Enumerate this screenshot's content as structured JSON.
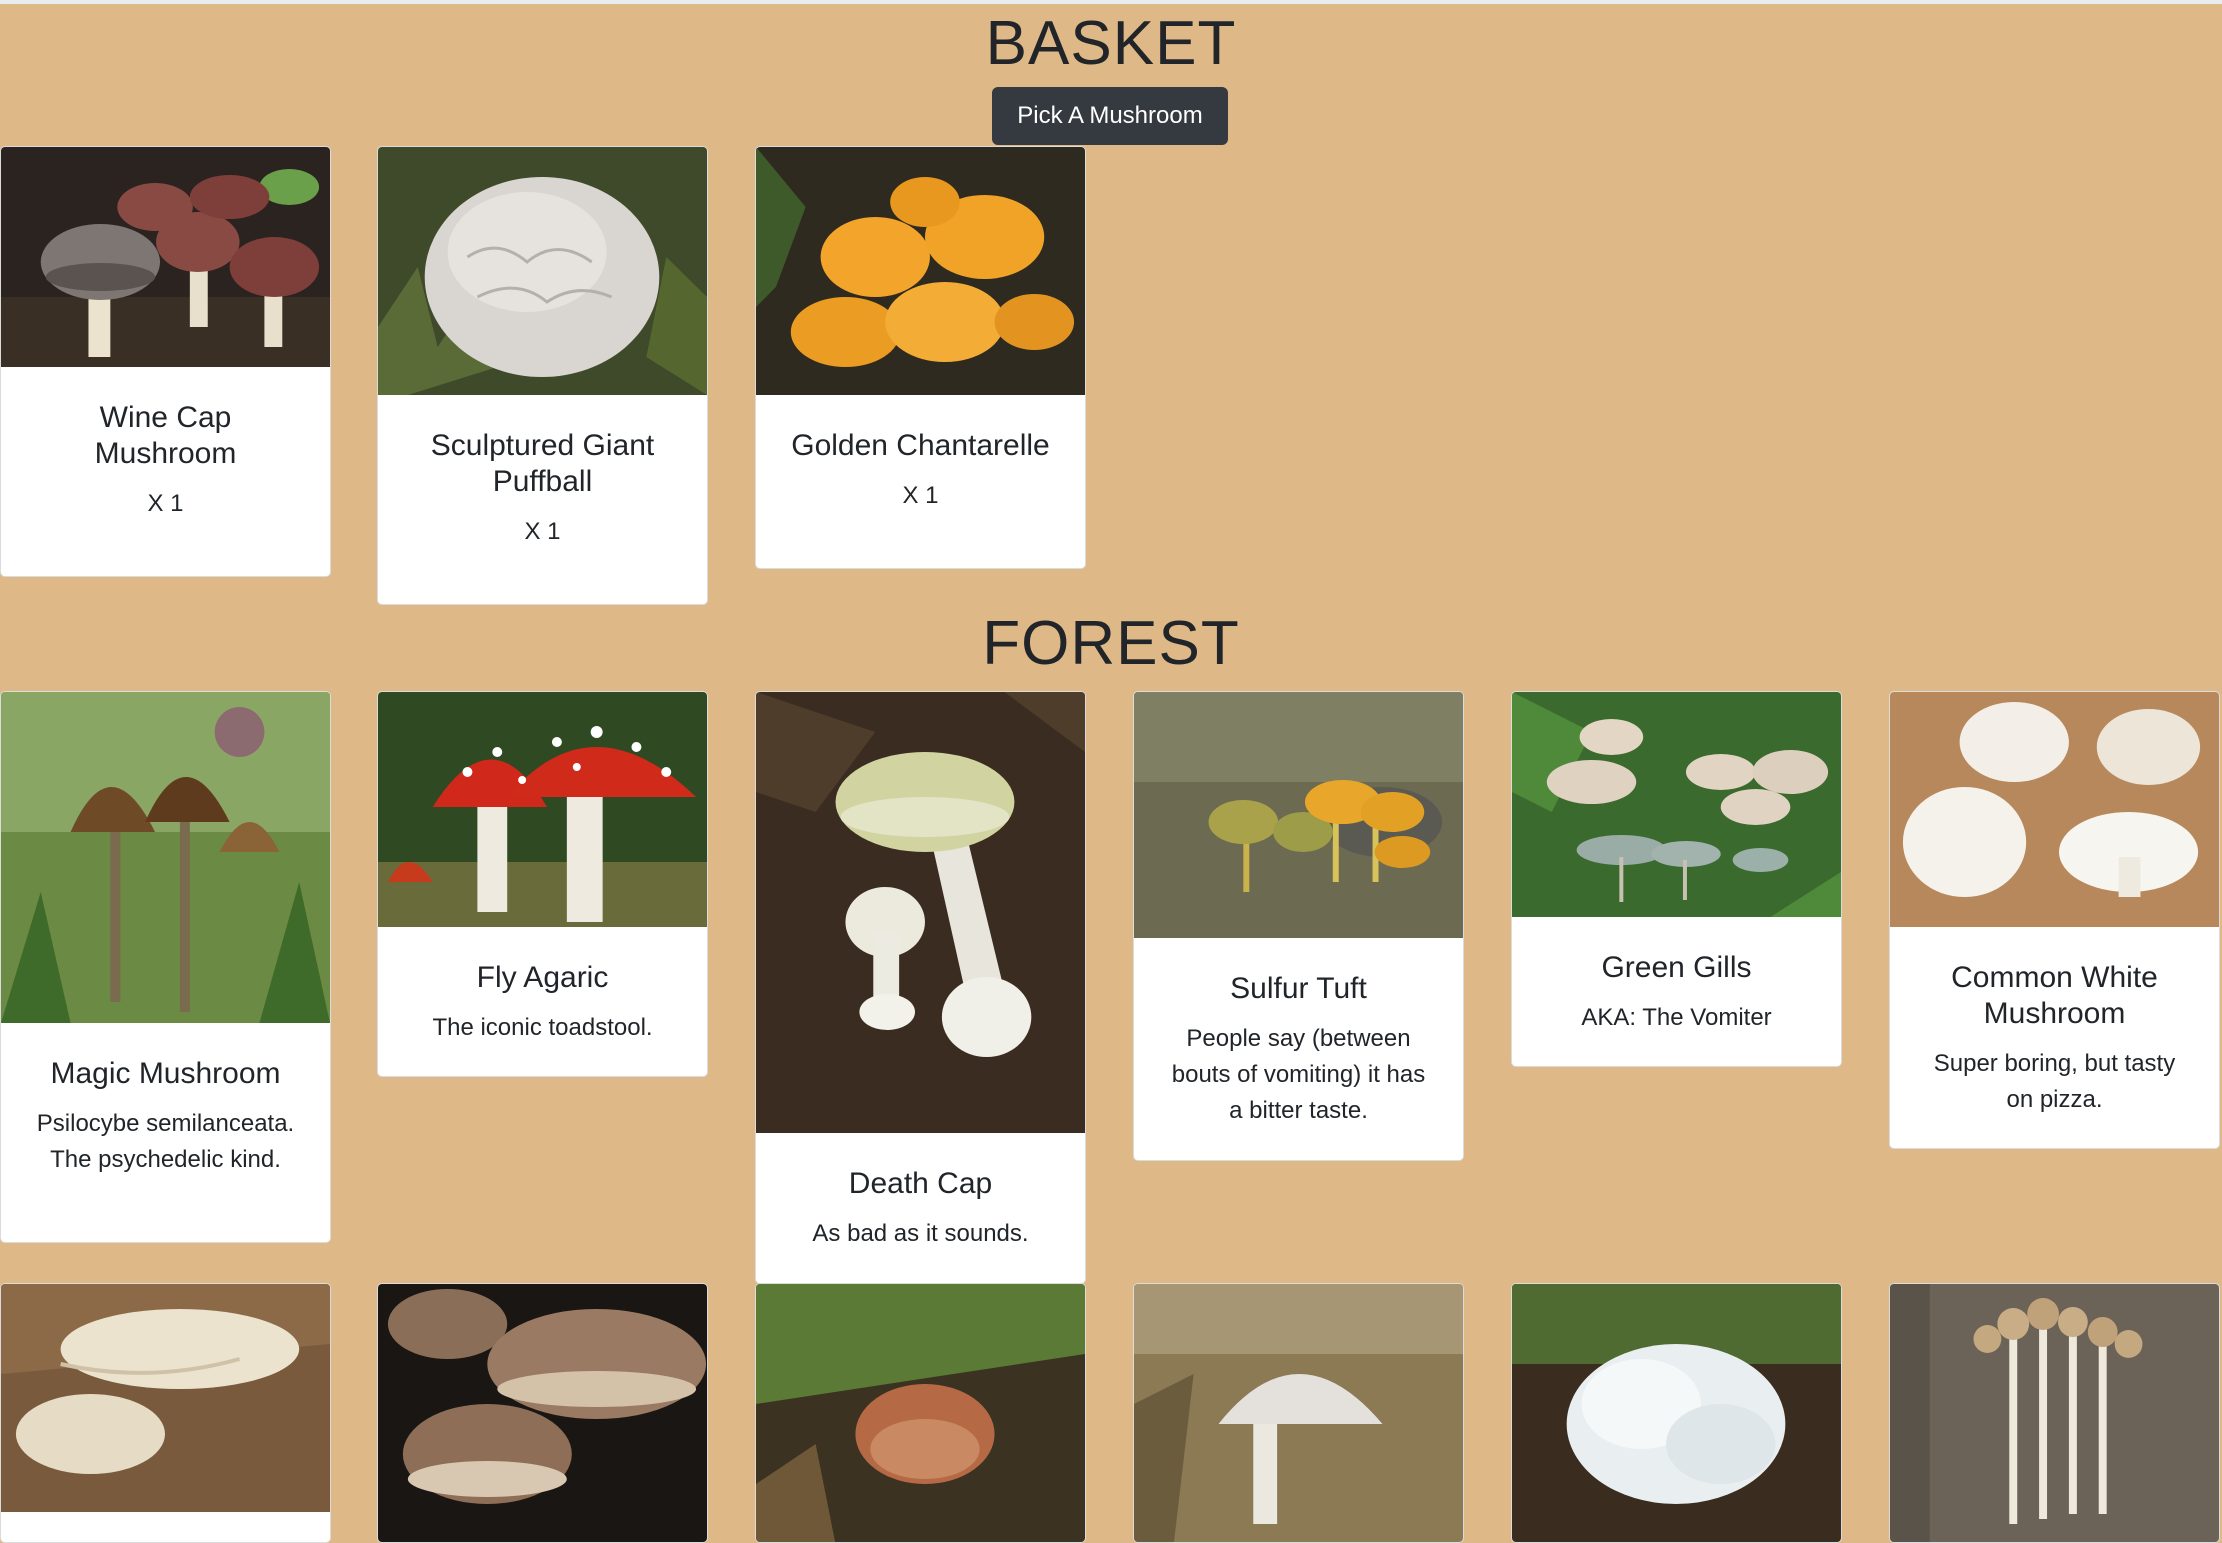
{
  "basket": {
    "title": "BASKET",
    "button_label": "Pick A Mushroom",
    "items": [
      {
        "name": "Wine Cap Mushroom",
        "qty": "X 1",
        "icon": "wine-cap-photo"
      },
      {
        "name": "Sculptured Giant Puffball",
        "qty": "X 1",
        "icon": "puffball-photo"
      },
      {
        "name": "Golden Chantarelle",
        "qty": "X 1",
        "icon": "chanterelle-photo"
      }
    ]
  },
  "forest": {
    "title": "FOREST",
    "items": [
      {
        "name": "Magic Mushroom",
        "desc": "Psilocybe semilanceata. The psychedelic kind.",
        "icon": "magic-mushroom-photo"
      },
      {
        "name": "Fly Agaric",
        "desc": "The iconic toadstool.",
        "icon": "fly-agaric-photo"
      },
      {
        "name": "Death Cap",
        "desc": "As bad as it sounds.",
        "icon": "death-cap-photo"
      },
      {
        "name": "Sulfur Tuft",
        "desc": "People say (between bouts of vomiting) it has a bitter taste.",
        "icon": "sulfur-tuft-photo"
      },
      {
        "name": "Green Gills",
        "desc": "AKA: The Vomiter",
        "icon": "green-gills-photo"
      },
      {
        "name": "Common White Mushroom",
        "desc": "Super boring, but tasty on pizza.",
        "icon": "white-mushroom-photo"
      }
    ],
    "row3_icons": [
      "oyster-mushroom-photo",
      "shiitake-photo",
      "brown-cup-mushroom-photo",
      "white-parasol-photo",
      "snow-fungus-photo",
      "enoki-photo"
    ]
  },
  "colors": {
    "background": "#deb887",
    "button": "#343a40",
    "card": "#ffffff"
  }
}
